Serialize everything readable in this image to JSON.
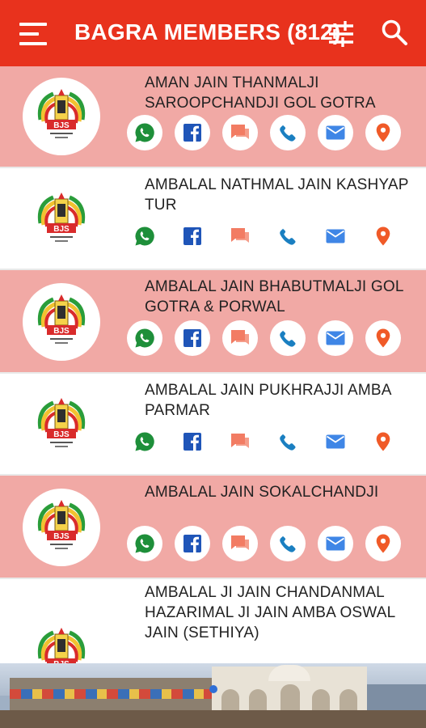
{
  "app_bar": {
    "title": "BAGRA MEMBERS (812)",
    "menu_icon": "hamburger-menu-icon",
    "filter_icon": "tune-sliders-icon",
    "search_icon": "search-icon",
    "color": "#e8321d"
  },
  "members": [
    {
      "name": "AMAN JAIN THANMALJI SAROOPCHANDJI GOL GOTRA",
      "logo_text": "BJS"
    },
    {
      "name": "AMBALAL NATHMAL JAIN KASHYAP TUR",
      "logo_text": "BJS"
    },
    {
      "name": "AMBALAL JAIN BHABUTMALJI GOL GOTRA & PORWAL",
      "logo_text": "BJS"
    },
    {
      "name": "AMBALAL JAIN PUKHRAJJI AMBA PARMAR",
      "logo_text": "BJS"
    },
    {
      "name": "AMBALAL JAIN SOKALCHANDJI",
      "logo_text": "BJS"
    },
    {
      "name": "AMBALAL JI JAIN CHANDANMAL HAZARIMAL JI JAIN AMBA OSWAL JAIN (SETHIYA)",
      "logo_text": "BJS"
    }
  ],
  "action_icons": [
    "whatsapp-icon",
    "facebook-icon",
    "message-icon",
    "phone-icon",
    "email-icon",
    "location-icon"
  ],
  "colors": {
    "row_highlight": "#f1a9a5",
    "whatsapp": "#1e8f3a",
    "facebook": "#1f55b8",
    "message": "#f27c63",
    "phone": "#1a7fc1",
    "email": "#3f86e6",
    "location": "#f05a28"
  }
}
